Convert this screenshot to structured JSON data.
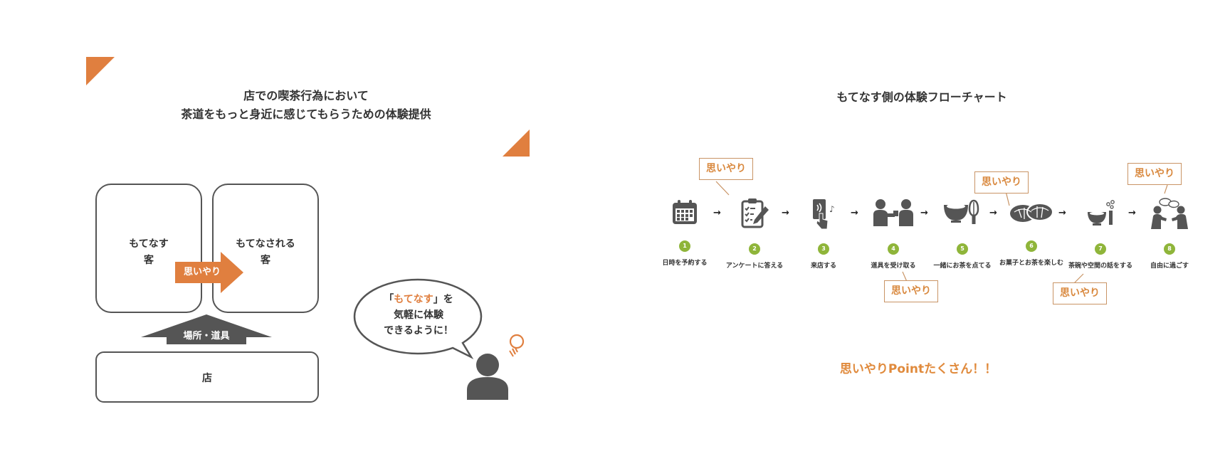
{
  "left_panel": {
    "title_line1": "店での喫茶行為において",
    "title_line2": "茶道をもっと身近に感じてもらうための体験提供",
    "box_host_line1": "もてなす",
    "box_host_line2": "客",
    "box_guest_line1": "もてなされる",
    "box_guest_line2": "客",
    "arrow_label": "思いやり",
    "support_label": "場所・道具",
    "store_label": "店",
    "bubble_line1_open": "「",
    "bubble_line1_highlight": "もてなす",
    "bubble_line1_close": "」を",
    "bubble_line2": "気軽に体験",
    "bubble_line3": "できるように！",
    "colors": {
      "accent": "#e07f3f",
      "dark": "#555555"
    },
    "icons": [
      "person-icon",
      "lightbulb-icon"
    ]
  },
  "right_panel": {
    "title": "もてなす側の体験フローチャート",
    "steps": [
      {
        "num": "1",
        "label": "日時を予約する",
        "icon": "calendar-icon"
      },
      {
        "num": "2",
        "label": "アンケートに答える",
        "icon": "clipboard-icon"
      },
      {
        "num": "3",
        "label": "来店する",
        "icon": "phone-tap-icon"
      },
      {
        "num": "4",
        "label": "道具を受け取る",
        "icon": "handover-icon"
      },
      {
        "num": "5",
        "label": "一緒にお茶を点てる",
        "icon": "tea-bowl-whisk-icon"
      },
      {
        "num": "6",
        "label": "お菓子とお茶を楽しむ",
        "icon": "sweets-icon"
      },
      {
        "num": "7",
        "label": "茶碗や空間の話をする",
        "icon": "bowl-flower-icon"
      },
      {
        "num": "8",
        "label": "自由に過ごす",
        "icon": "chatting-people-icon"
      }
    ],
    "arrow_glyph": "→",
    "omoiyari_label": "思いやり",
    "point_text": "思いやりPointたくさん！！",
    "colors": {
      "step_number": "#8fb53a",
      "callout_border": "#c99465",
      "callout_text": "#d9893f"
    }
  }
}
